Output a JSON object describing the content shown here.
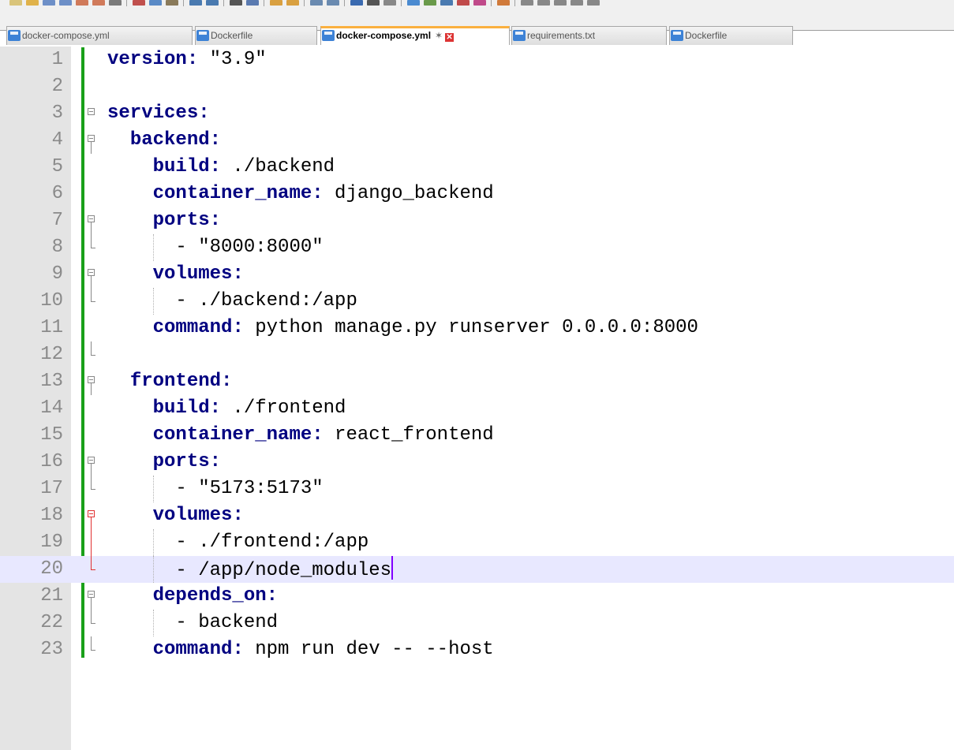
{
  "tabs": [
    {
      "label": "docker-compose.yml",
      "active": false
    },
    {
      "label": "Dockerfile",
      "active": false
    },
    {
      "label": "docker-compose.yml",
      "active": true
    },
    {
      "label": "requirements.txt",
      "active": false
    },
    {
      "label": "Dockerfile",
      "active": false
    }
  ],
  "active_tab_pin": "✶",
  "active_tab_close": "✕",
  "editor": {
    "current_line": 20,
    "lines": [
      {
        "n": "1",
        "indent": "",
        "key": "version",
        "rest": " \"3.9\""
      },
      {
        "n": "2",
        "indent": "",
        "key": "",
        "rest": ""
      },
      {
        "n": "3",
        "indent": "",
        "key": "services",
        "rest": ""
      },
      {
        "n": "4",
        "indent": "  ",
        "key": "backend",
        "rest": ""
      },
      {
        "n": "5",
        "indent": "    ",
        "key": "build",
        "rest": " ./backend"
      },
      {
        "n": "6",
        "indent": "    ",
        "key": "container_name",
        "rest": " django_backend"
      },
      {
        "n": "7",
        "indent": "    ",
        "key": "ports",
        "rest": ""
      },
      {
        "n": "8",
        "indent": "      ",
        "key": "",
        "rest": "- \"8000:8000\""
      },
      {
        "n": "9",
        "indent": "    ",
        "key": "volumes",
        "rest": ""
      },
      {
        "n": "10",
        "indent": "      ",
        "key": "",
        "rest": "- ./backend:/app"
      },
      {
        "n": "11",
        "indent": "    ",
        "key": "command",
        "rest": " python manage.py runserver 0.0.0.0:8000"
      },
      {
        "n": "12",
        "indent": "",
        "key": "",
        "rest": ""
      },
      {
        "n": "13",
        "indent": "  ",
        "key": "frontend",
        "rest": ""
      },
      {
        "n": "14",
        "indent": "    ",
        "key": "build",
        "rest": " ./frontend"
      },
      {
        "n": "15",
        "indent": "    ",
        "key": "container_name",
        "rest": " react_frontend"
      },
      {
        "n": "16",
        "indent": "    ",
        "key": "ports",
        "rest": ""
      },
      {
        "n": "17",
        "indent": "      ",
        "key": "",
        "rest": "- \"5173:5173\""
      },
      {
        "n": "18",
        "indent": "    ",
        "key": "volumes",
        "rest": ""
      },
      {
        "n": "19",
        "indent": "      ",
        "key": "",
        "rest": "- ./frontend:/app"
      },
      {
        "n": "20",
        "indent": "      ",
        "key": "",
        "rest": "- /app/node_modules"
      },
      {
        "n": "21",
        "indent": "    ",
        "key": "depends_on",
        "rest": ""
      },
      {
        "n": "22",
        "indent": "      ",
        "key": "",
        "rest": "- backend"
      },
      {
        "n": "23",
        "indent": "    ",
        "key": "command",
        "rest": " npm run dev -- --host"
      }
    ]
  }
}
